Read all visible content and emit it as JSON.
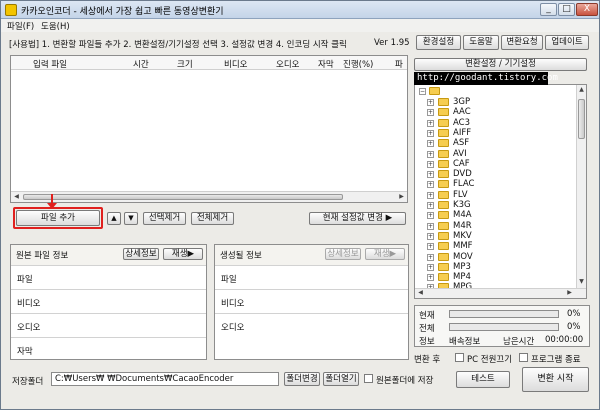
{
  "window": {
    "title": "카카오인코더 - 세상에서 가장 쉽고 빠른 동영상변환기",
    "controls": [
      "_",
      "□",
      "X"
    ]
  },
  "menu": [
    "파일(F)",
    "도움(H)"
  ],
  "steps_text": "[사용법] 1. 변환할 파일들 추가  2. 변환설정/기기설정 선택  3. 설정값 변경  4. 인코딩 시작 클릭",
  "version": "Ver 1.95",
  "top_buttons": [
    "환경설정",
    "도움말",
    "변환요청",
    "업데이트"
  ],
  "file_table": {
    "columns": [
      "입력 파일",
      "시간",
      "크기",
      "비디오",
      "오디오",
      "자막",
      "진행(%)",
      "파"
    ]
  },
  "left_controls": {
    "add_file": "파일 추가",
    "up_arrow": "▲",
    "down_arrow": "▼",
    "remove_selected": "선택제거",
    "remove_all": "전체제거",
    "change_current": "현재 설정값 변경 ▶"
  },
  "source_info": {
    "title": "원본 파일 정보",
    "detail_btn": "상세정보",
    "play_btn": "재생▶",
    "rows": [
      "파일",
      "비디오",
      "오디오",
      "자막"
    ]
  },
  "output_info": {
    "title": "생성될 정보",
    "detail_btn": "상세정보",
    "play_btn": "재생▶",
    "rows": [
      "파일",
      "비디오",
      "오디오"
    ]
  },
  "right_panel": {
    "convert_settings_label": "변환설정 / 기기설정",
    "watermark_text": "http://goodant.tistory.com",
    "formats": [
      "3GP",
      "AAC",
      "AC3",
      "AIFF",
      "ASF",
      "AVI",
      "CAF",
      "DVD",
      "FLAC",
      "FLV",
      "K3G",
      "M4A",
      "M4R",
      "MKV",
      "MMF",
      "MOV",
      "MP3",
      "MP4",
      "MPG"
    ]
  },
  "progress": {
    "current_label": "현재",
    "total_label": "전체",
    "current_value": "0%",
    "total_value": "0%",
    "current_fraction": 0,
    "total_fraction": 0,
    "info_label": "정보",
    "speed_label": "배속정보",
    "remaining_label": "남은시간",
    "remaining_value": "00:00:00"
  },
  "after_convert": {
    "label": "변환 후",
    "pc_off": "PC 전원끄기",
    "program_exit": "프로그램 종료"
  },
  "save": {
    "label": "저장폴더",
    "path": "C:₩Users₩      ₩Documents₩CacaoEncoder",
    "change_btn": "폴더변경",
    "open_btn": "폴더열기",
    "same_folder": "원본폴더에 저장"
  },
  "bottom_buttons": {
    "test": "테스트",
    "start": "변환 시작"
  },
  "colors": {
    "accent_red": "#e0201e",
    "title_bar": "#c4d4e8",
    "folder": "#f6cd4f"
  }
}
